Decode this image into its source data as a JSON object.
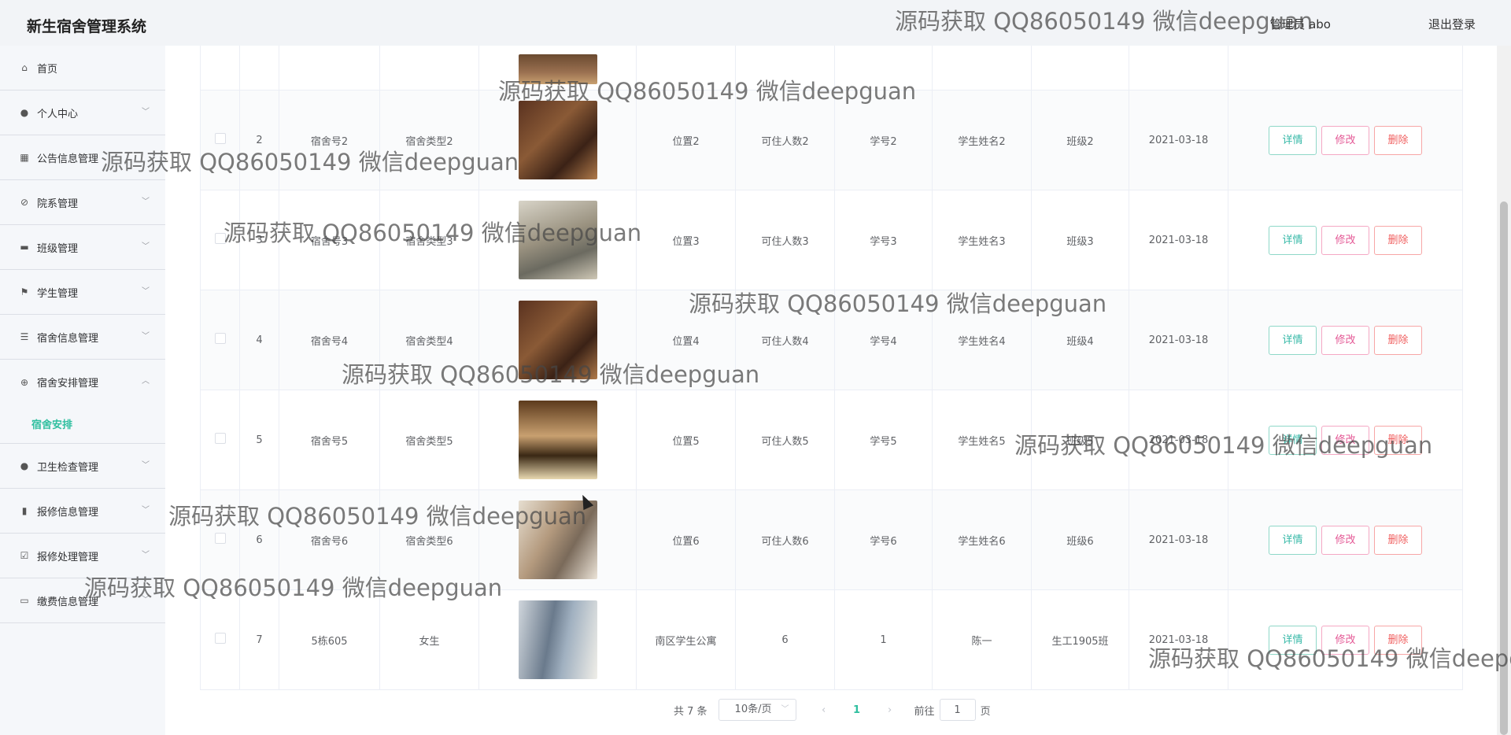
{
  "app": {
    "title": "新生宿舍管理系统",
    "admin_label": "管理员 abo",
    "logout_label": "退出登录"
  },
  "sidebar": {
    "items": [
      {
        "label": "首页",
        "icon": "home-icon"
      },
      {
        "label": "个人中心",
        "icon": "user-icon"
      },
      {
        "label": "公告信息管理",
        "icon": "grid-icon"
      },
      {
        "label": "院系管理",
        "icon": "slash-circle-icon"
      },
      {
        "label": "班级管理",
        "icon": "chat-icon"
      },
      {
        "label": "学生管理",
        "icon": "flag-icon"
      },
      {
        "label": "宿舍信息管理",
        "icon": "list-icon"
      },
      {
        "label": "宿舍安排管理",
        "icon": "compass-icon",
        "expanded": true
      },
      {
        "label": "卫生检查管理",
        "icon": "user-icon"
      },
      {
        "label": "报修信息管理",
        "icon": "bar-chart-icon"
      },
      {
        "label": "报修处理管理",
        "icon": "check-square-icon"
      },
      {
        "label": "缴费信息管理",
        "icon": "chat-icon"
      }
    ],
    "active_submenu": "宿舍安排"
  },
  "table": {
    "rows": [
      {
        "index": "2",
        "room_no": "宿舍号2",
        "room_type": "宿舍类型2",
        "location": "位置2",
        "capacity": "可住人数2",
        "student_no": "学号2",
        "student_name": "学生姓名2",
        "class_name": "班级2",
        "date": "2021-03-18"
      },
      {
        "index": "3",
        "room_no": "宿舍号3",
        "room_type": "宿舍类型3",
        "location": "位置3",
        "capacity": "可住人数3",
        "student_no": "学号3",
        "student_name": "学生姓名3",
        "class_name": "班级3",
        "date": "2021-03-18"
      },
      {
        "index": "4",
        "room_no": "宿舍号4",
        "room_type": "宿舍类型4",
        "location": "位置4",
        "capacity": "可住人数4",
        "student_no": "学号4",
        "student_name": "学生姓名4",
        "class_name": "班级4",
        "date": "2021-03-18"
      },
      {
        "index": "5",
        "room_no": "宿舍号5",
        "room_type": "宿舍类型5",
        "location": "位置5",
        "capacity": "可住人数5",
        "student_no": "学号5",
        "student_name": "学生姓名5",
        "class_name": "班级5",
        "date": "2021-03-18"
      },
      {
        "index": "6",
        "room_no": "宿舍号6",
        "room_type": "宿舍类型6",
        "location": "位置6",
        "capacity": "可住人数6",
        "student_no": "学号6",
        "student_name": "学生姓名6",
        "class_name": "班级6",
        "date": "2021-03-18"
      },
      {
        "index": "7",
        "room_no": "5栋605",
        "room_type": "女生",
        "location": "南区学生公寓",
        "capacity": "6",
        "student_no": "1",
        "student_name": "陈一",
        "class_name": "生工1905班",
        "date": "2021-03-18"
      }
    ],
    "actions": {
      "detail": "详情",
      "edit": "修改",
      "delete": "删除"
    }
  },
  "pagination": {
    "total": "共 7 条",
    "page_size": "10条/页",
    "prev": "‹",
    "current": "1",
    "next": "›",
    "goto_prefix": "前往",
    "goto_value": "1",
    "goto_suffix": "页"
  },
  "watermark": "源码获取 QQ86050149 微信deepguan"
}
